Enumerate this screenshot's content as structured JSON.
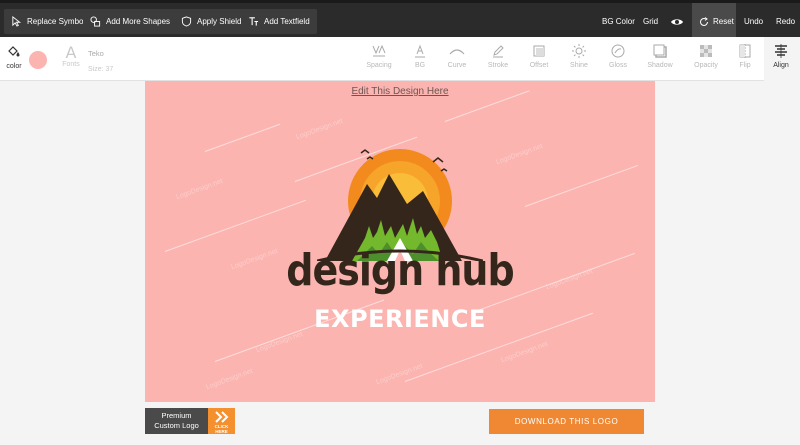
{
  "topbar": {
    "replace_symbol": "Replace Symbol",
    "add_more_shapes": "Add More Shapes",
    "apply_shield": "Apply Shield",
    "add_textfield": "Add Textfield",
    "bg_color": "BG Color",
    "grid": "Grid",
    "reset": "Reset",
    "undo": "Undo",
    "redo": "Redo"
  },
  "toolbar": {
    "color_label": "color",
    "swatch_color": "#fbb4b0",
    "fonts_label": "Fonts",
    "font_name": "Teko",
    "size_label": "Size: 37",
    "tools": [
      "Spacing",
      "BG",
      "Curve",
      "Stroke",
      "Offset",
      "Shine",
      "Gloss",
      "Shadow",
      "Opacity",
      "Flip",
      "Align"
    ]
  },
  "canvas": {
    "edit_link": "Edit This Design Here",
    "watermark": "LogoDesign.net",
    "background": "#fbb4b0",
    "logo_name": "design hub",
    "logo_tagline": "EXPERIENCE"
  },
  "footer": {
    "premium_line1": "Premium",
    "premium_line2": "Custom Logo",
    "click_here": "CLICK HERE",
    "download": "DOWNLOAD THIS LOGO"
  }
}
